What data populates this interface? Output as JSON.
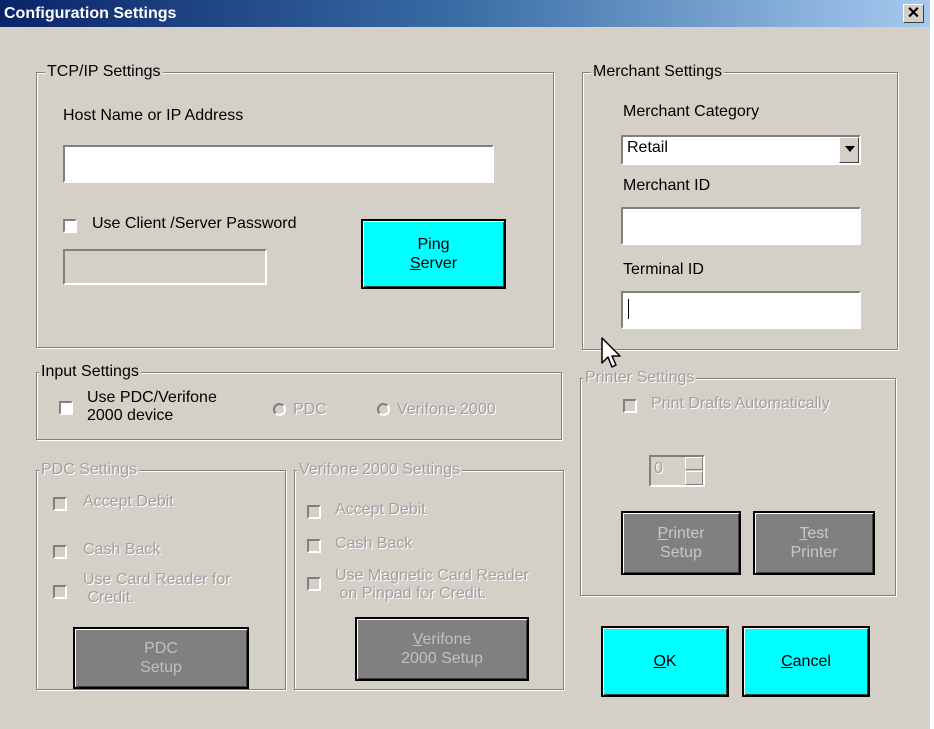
{
  "window": {
    "title": "Configuration Settings",
    "close_glyph": "✕"
  },
  "tcpip": {
    "legend": "TCP/IP Settings",
    "host_label": "Host Name or IP Address",
    "host_value": "",
    "use_password_label": "Use Client /Server Password",
    "use_password_checked": false,
    "password_value": "",
    "ping_button": {
      "line1": "Ping",
      "line2_accel": "S",
      "line2_rest": "erver"
    }
  },
  "merchant": {
    "legend": "Merchant Settings",
    "category_label": "Merchant Category",
    "category_value": "Retail",
    "merchant_id_label": "Merchant ID",
    "merchant_id_value": "",
    "terminal_id_label": "Terminal ID",
    "terminal_id_value": ""
  },
  "input": {
    "legend": "Input Settings",
    "use_device_label_line1": "Use PDC/Verifone",
    "use_device_label_line2": "2000 device",
    "radio_pdc": "PDC",
    "radio_verifone": "Verifone 2000"
  },
  "printer": {
    "legend": "Printer Settings",
    "print_drafts_label": "Print Drafts Automatically",
    "copies_value": "0",
    "setup_button": {
      "line1_accel": "P",
      "line1_rest": "rinter",
      "line2": "Setup"
    },
    "test_button": {
      "line1_accel": "T",
      "line1_rest": "est",
      "line2": "Printer"
    }
  },
  "pdc": {
    "legend": "PDC Settings",
    "accept_debit": "Accept Debit",
    "cash_back": "Cash Back",
    "card_reader_line1": "Use Card Reader for",
    "card_reader_line2": "Credit.",
    "setup_button": {
      "line1": "PDC",
      "line2": "Setup"
    }
  },
  "verifone": {
    "legend": "Verifone 2000 Settings",
    "accept_debit": "Accept Debit",
    "cash_back": "Cash Back",
    "mag_reader_line1": "Use Magnetic Card Reader",
    "mag_reader_line2": "on Pinpad for Credit.",
    "setup_button": {
      "line1_accel": "V",
      "line1_rest": "erifone",
      "line2": "2000 Setup"
    }
  },
  "actions": {
    "ok": {
      "accel": "O",
      "rest": "K"
    },
    "cancel": {
      "accel": "C",
      "rest": "ancel"
    }
  },
  "colors": {
    "dialog_bg": "#d4d0c8",
    "title_start": "#0a246a",
    "accent_button": "#00ffff",
    "disabled_button": "#808080"
  }
}
